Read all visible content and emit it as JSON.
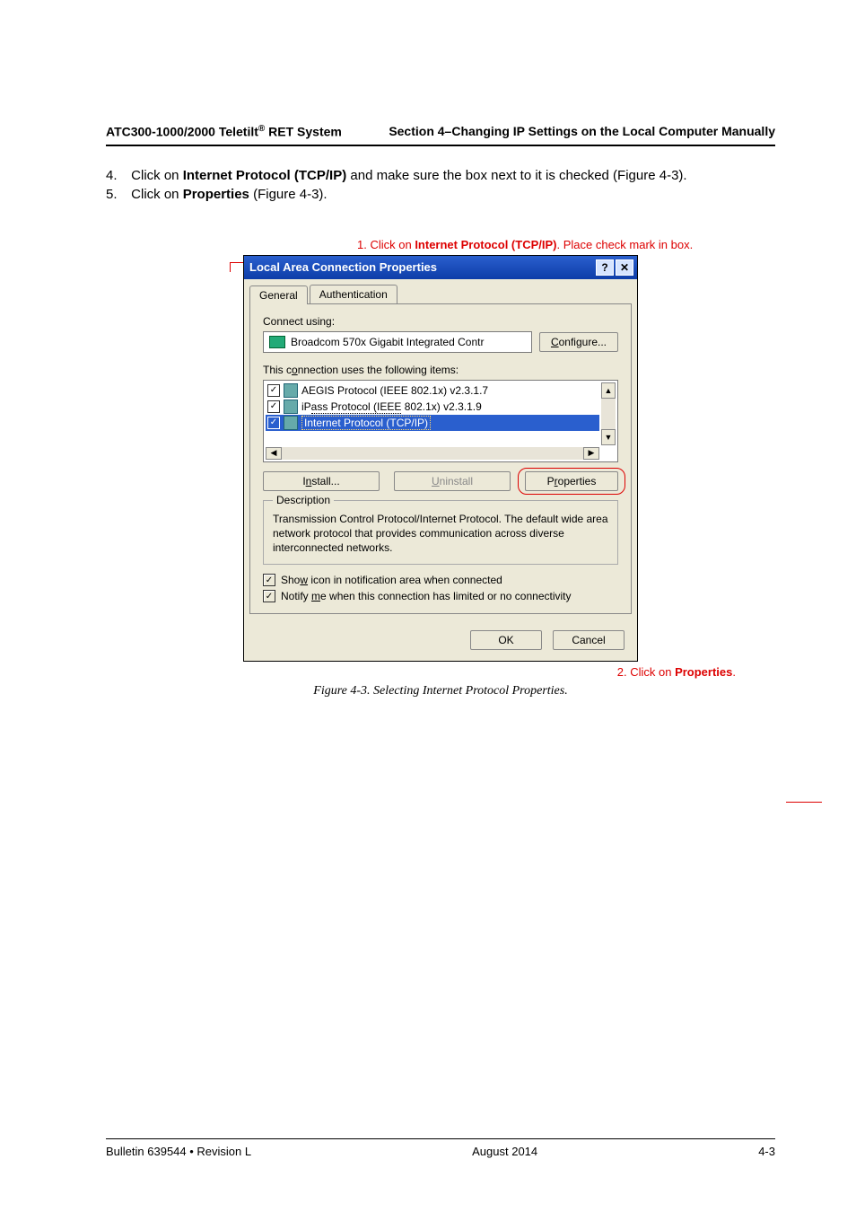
{
  "header": {
    "left_a": "ATC300-1000/2000 Teletilt",
    "left_b": " RET System",
    "right": "Section 4–Changing IP Settings on the Local Computer Manually",
    "sup": "®"
  },
  "steps": {
    "s4_num": "4.",
    "s4_a": "Click on ",
    "s4_b": "Internet Protocol (TCP/IP)",
    "s4_c": " and make sure the box next to it is checked (Figure 4-3).",
    "s5_num": "5.",
    "s5_a": "Click on ",
    "s5_b": "Properties",
    "s5_c": " (Figure 4-3)."
  },
  "callout1": {
    "pre": "1. Click on ",
    "bold": "Internet Protocol (TCP/IP)",
    "post": ". Place check mark in box."
  },
  "dialog": {
    "title": "Local Area Connection Properties",
    "help": "?",
    "close": "✕",
    "tab_general": "General",
    "tab_auth": "Authentication",
    "connect_using": "Connect using:",
    "adapter": "Broadcom 570x Gigabit Integrated Contr",
    "configure_u": "C",
    "configure": "onfigure...",
    "items_label_a": "This c",
    "items_label_u": "o",
    "items_label_b": "nnection uses the following items:",
    "item1": "AEGIS Protocol (IEEE 802.1x) v2.3.1.7",
    "item2_a": "iP",
    "item2_b": "ass Protocol (IEEE",
    "item2_c": " 802.1x) v2.3.1.9",
    "item3": "Internet Protocol (TCP/IP)",
    "check": "✓",
    "install_a": "I",
    "install_u": "n",
    "install_b": "stall...",
    "uninstall_u": "U",
    "uninstall": "ninstall",
    "props_a": "P",
    "props_u": "r",
    "props_b": "operties",
    "desc_legend": "Description",
    "desc_text": "Transmission Control Protocol/Internet Protocol. The default wide area network protocol that provides communication across diverse interconnected networks.",
    "show_a": "Sho",
    "show_u": "w",
    "show_b": " icon in notification area when connected",
    "notify_a": "Notify ",
    "notify_u": "m",
    "notify_b": "e when this connection has limited or no connectivity",
    "ok": "OK",
    "cancel": "Cancel",
    "up": "▲",
    "down": "▼",
    "left": "◀",
    "right": "▶"
  },
  "callout2": {
    "pre": "2. Click on ",
    "bold": "Properties",
    "post": "."
  },
  "figcap": "Figure 4-3.  Selecting Internet Protocol Properties.",
  "footer": {
    "left": "Bulletin 639544  •  Revision L",
    "center": "August 2014",
    "right": "4-3"
  }
}
